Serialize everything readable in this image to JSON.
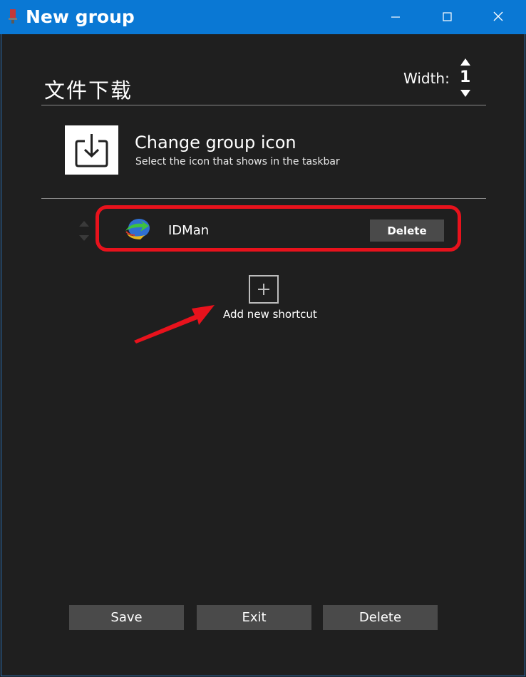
{
  "window": {
    "title": "New group"
  },
  "group": {
    "name": "文件下载",
    "width_label": "Width:",
    "width_value": "1"
  },
  "icon_section": {
    "title": "Change group icon",
    "subtitle": "Select the icon that shows in the taskbar"
  },
  "shortcuts": [
    {
      "name": "IDMan",
      "delete_label": "Delete"
    }
  ],
  "add": {
    "label": "Add new shortcut"
  },
  "footer": {
    "save_label": "Save",
    "exit_label": "Exit",
    "delete_label": "Delete"
  },
  "colors": {
    "titlebar": "#0a78d4",
    "background": "#1f1f1f",
    "highlight": "#e8121c",
    "button": "#4a4a4a"
  }
}
